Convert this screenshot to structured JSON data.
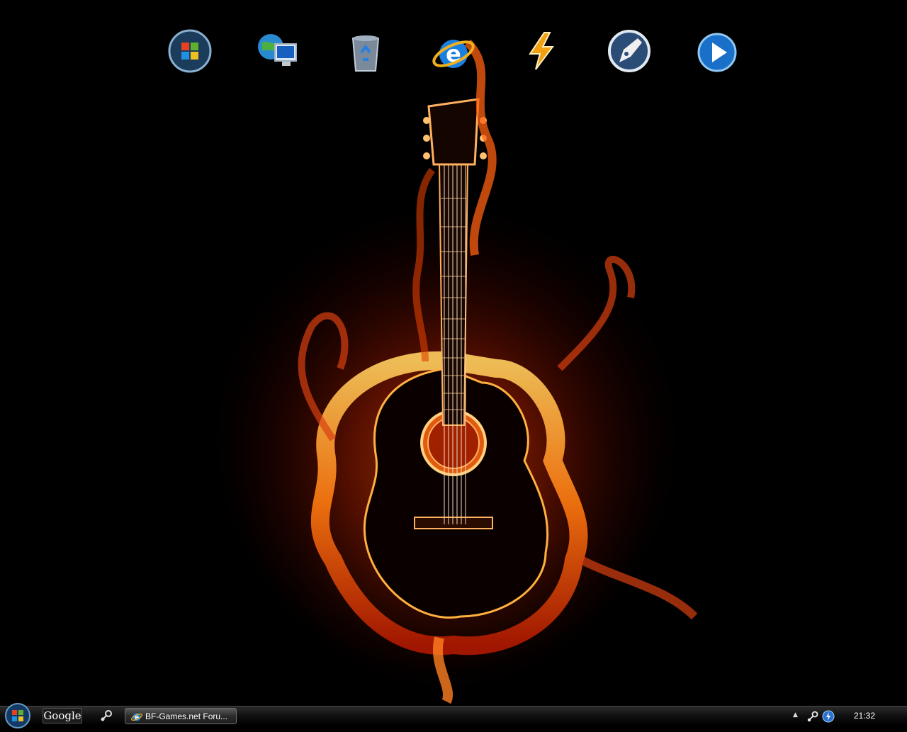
{
  "desktop": {
    "wallpaper": "flaming-acoustic-guitar",
    "dock_icons": [
      {
        "name": "windows-start-icon"
      },
      {
        "name": "network-computer-icon"
      },
      {
        "name": "recycle-bin-icon"
      },
      {
        "name": "internet-explorer-icon"
      },
      {
        "name": "winamp-icon"
      },
      {
        "name": "pen-tool-icon"
      },
      {
        "name": "media-player-icon"
      }
    ]
  },
  "taskbar": {
    "google_label": "Google",
    "task_title": "BF-Games.net Foru...",
    "clock": "21:32",
    "tray_arrow": "▲"
  },
  "colors": {
    "flame": "#ff6a00",
    "taskbar": "#121212"
  }
}
